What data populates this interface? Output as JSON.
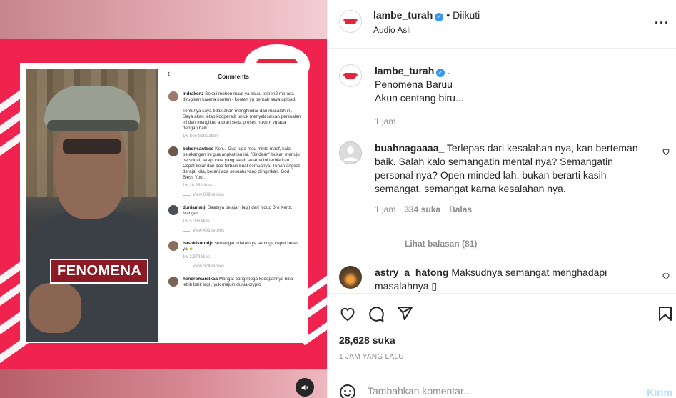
{
  "media": {
    "overlay_text": "FENOMENA",
    "comments_title": "Comments",
    "comments": [
      {
        "user": "indrakenz",
        "text": "Sekali mohon maaf ya kalau temen2 merasa dirugikan karena konten - konten yg pernah saya upload.\n\nTentunya saya tidak akan menghindar dari masalah ini. Saya akan tetap kooperatif untuk menyelesaikan persoalan ini dan mengikuti aturan serta proses hukum yg ada dengan baik.",
        "meta": "1w   See translation"
      },
      {
        "user": "bobonsantoso",
        "text": "Ken... Gua juga mau minta maaf, kalo belakangan ini gua angkat isu ini. \"Sindiran\" bukan menuju personal, tetapi cara yang salah selama ini terbiarkan. Cepat kelar dan doa terbaik buat semuanya. Tuhan angkat derajat kita, berarti ada sesuatu yang diinginkan. God Bless You..",
        "meta": "1w   28.352 likes",
        "replies": "View 609 replies"
      },
      {
        "user": "duniamanji",
        "text": "Saatnya belajar (lagi) dari hidup Bro Kenz. Mangat.",
        "meta": "1w   5.096 likes",
        "replies": "View 401 replies"
      },
      {
        "user": "basukisurodjo",
        "text": "semangat ndanku ya semoga cepet beres ya",
        "meta": "1w   2.979 likes",
        "replies": "View 374 replies"
      },
      {
        "user": "hendromardikaa",
        "text": "Mangat bang moga kedepannya bisa lebih baik lagi , yuk majuin dunia crypto",
        "meta": ""
      }
    ]
  },
  "header": {
    "username": "lambe_turah",
    "separator": "•",
    "follow_status": "Diikuti",
    "audio": "Audio Asli"
  },
  "caption": {
    "username": "lambe_turah",
    "suffix": ".",
    "line1": "Penomena Baruu",
    "line2": "Akun centang biru...",
    "time": "1 jam"
  },
  "comments": [
    {
      "username": "buahnagaaaa_",
      "text": "Terlepas dari kesalahan nya, kan berteman baik. Salah kalo semangatin mental nya? Semangatin personal nya? Open minded lah, bukan berarti kasih semangat, semangat karna kesalahan nya.",
      "time": "1 jam",
      "likes": "334 suka",
      "reply": "Balas",
      "view_replies": "Lihat balasan (81)"
    },
    {
      "username": "astry_a_hatong",
      "text": "Maksudnya semangat menghadapi masalahnya ",
      "glyph": "▯"
    }
  ],
  "stats": {
    "likes": "28,628 suka",
    "ago": "1 JAM YANG LALU"
  },
  "comment_box": {
    "placeholder": "Tambahkan komentar...",
    "send": "Kirim"
  },
  "icons": [
    "more-icon",
    "heart-icon",
    "comment-icon",
    "share-icon",
    "bookmark-icon",
    "emoji-icon",
    "sound-icon",
    "verified-icon"
  ],
  "colors": {
    "brand_red": "#f0234f",
    "verified": "#3897f0",
    "send_disabled": "#b2dffc"
  }
}
